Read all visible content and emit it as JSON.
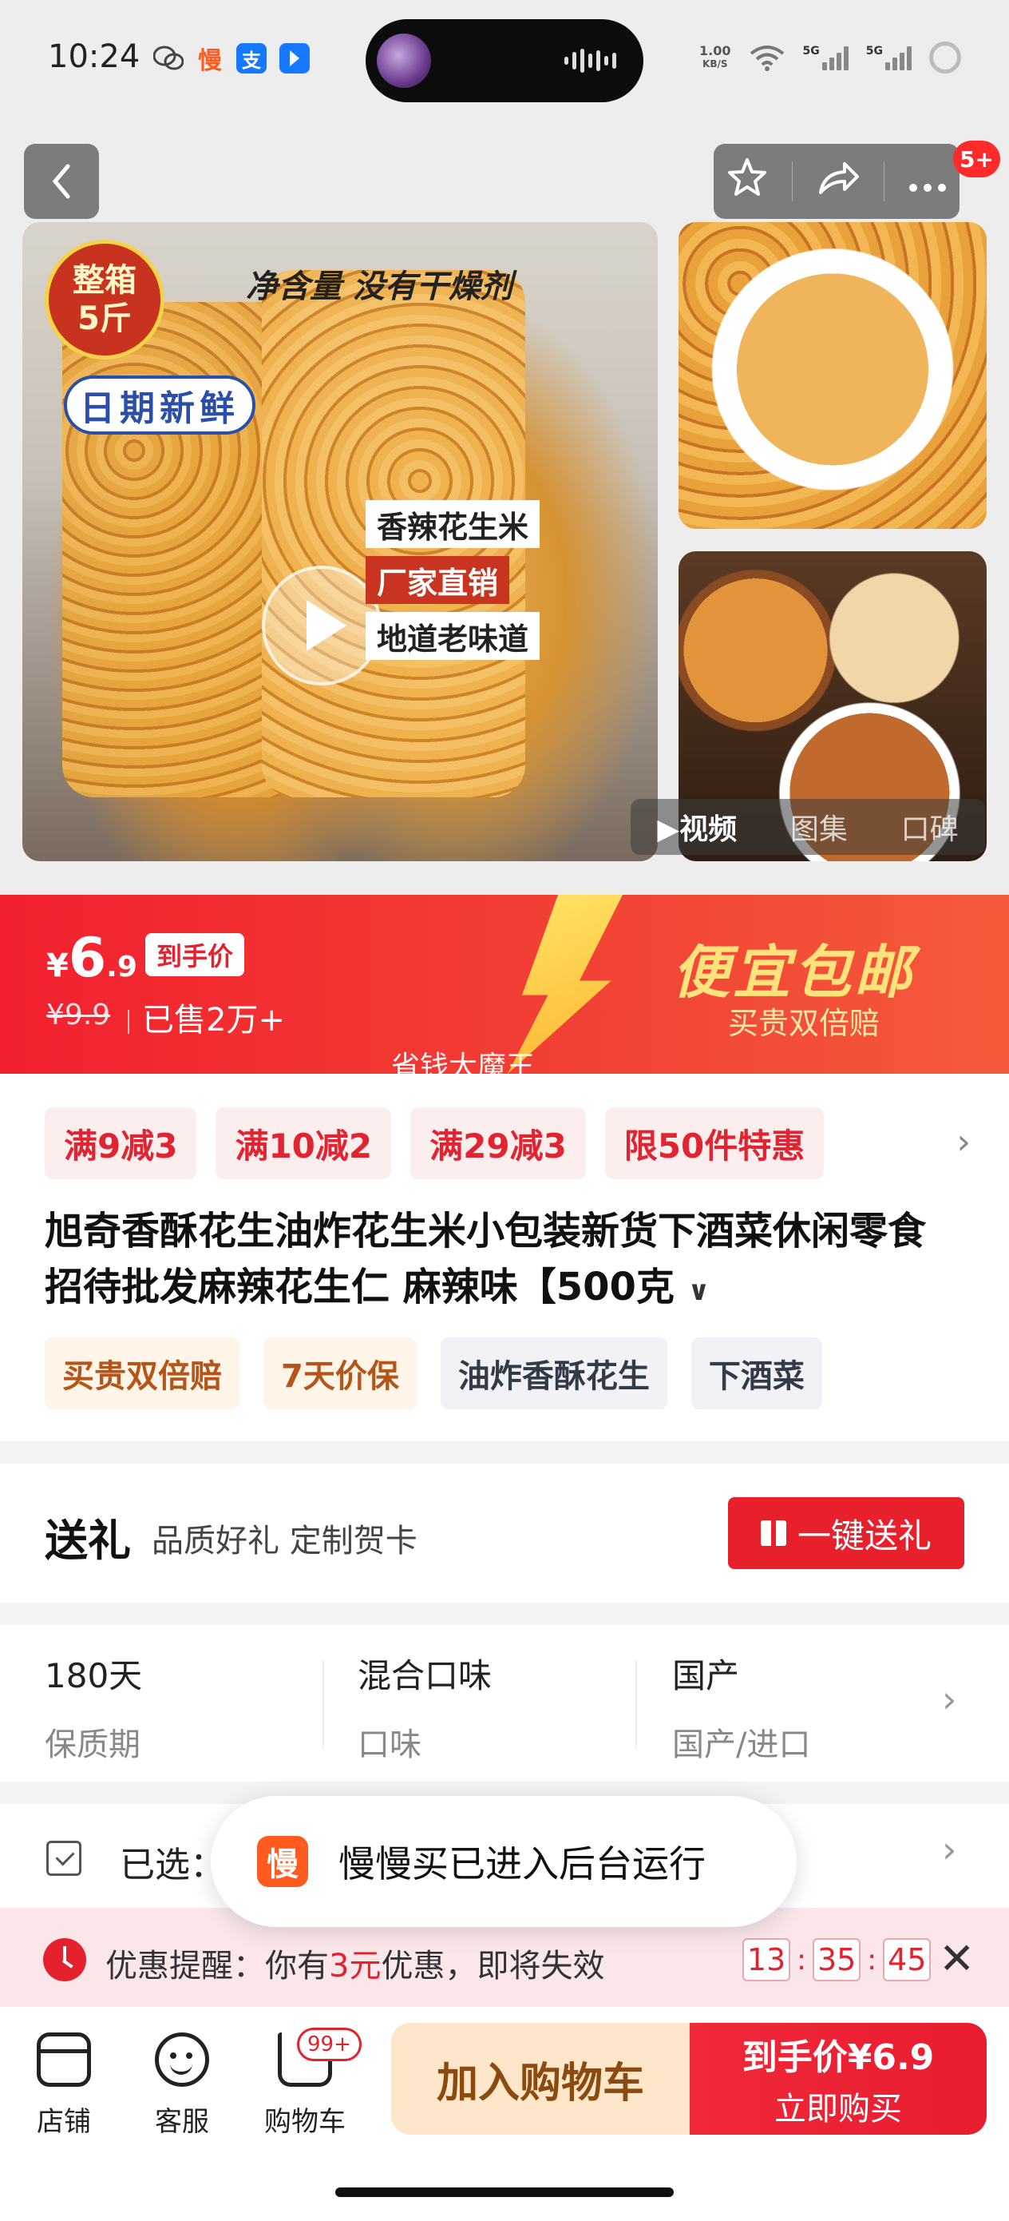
{
  "status_bar": {
    "time": "10:24",
    "app_icons": [
      "wechat-icon",
      "manmanmai-icon",
      "alipay-icon",
      "app-arrow-icon"
    ],
    "manmanmai_char": "慢",
    "alipay_char": "支",
    "net_speed_value": "1.00",
    "net_speed_unit": "KB/S",
    "sim1_label": "5G",
    "sim2_label": "5G"
  },
  "gallery": {
    "badge_count": "5+",
    "main_image": {
      "stamp_line1": "整箱",
      "stamp_line2": "5斤",
      "net_weight_text": "净含量  没有干燥剂",
      "fresh_text": "日期新鲜",
      "tagline1": "香辣花生米",
      "tagline2": "厂家直销",
      "tagline3": "地道老味道"
    },
    "media_tabs": [
      "视频",
      "图集",
      "口碑"
    ],
    "active_tab": "视频"
  },
  "price_banner": {
    "currency": "¥",
    "price_int": "6",
    "price_dec": ".9",
    "price_tag": "到手价",
    "old_price": "¥9.9",
    "sold": "已售2万+",
    "promo_big": "便宜包邮",
    "promo_small": "买贵双倍赔",
    "watermark": "省钱大魔王"
  },
  "info": {
    "coupons": [
      "满9减3",
      "满10减2",
      "满29减3",
      "限50件特惠"
    ],
    "title": "旭奇香酥花生油炸花生米小包装新货下酒菜休闲零食招待批发麻辣花生仁 麻辣味【500克",
    "chips": [
      {
        "label": "买贵双倍赔",
        "style": "orange"
      },
      {
        "label": "7天价保",
        "style": "orange"
      },
      {
        "label": "油炸香酥花生",
        "style": "gray"
      },
      {
        "label": "下酒菜",
        "style": "gray"
      }
    ]
  },
  "gift": {
    "title": "送礼",
    "subtitle": "品质好礼 定制贺卡",
    "button": "一键送礼"
  },
  "specs": [
    {
      "value": "180天",
      "key": "保质期"
    },
    {
      "value": "混合口味",
      "key": "口味"
    },
    {
      "value": "国产",
      "key": "国产/进口"
    }
  ],
  "selected": {
    "label": "已选："
  },
  "toast": {
    "logo_char": "慢",
    "text": "慢慢买已进入后台运行"
  },
  "reminder": {
    "prefix": "优惠提醒：你有",
    "amount": "3元",
    "suffix": "优惠，即将失效",
    "timer": {
      "h": "13",
      "m": "35",
      "s": "45"
    }
  },
  "bottom_bar": {
    "tabs": [
      "店铺",
      "客服",
      "购物车"
    ],
    "cart_badge": "99+",
    "add_to_cart": "加入购物车",
    "buy_line1": "到手价¥6.9",
    "buy_line2": "立即购买"
  },
  "colors": {
    "accent_red": "#e5212e",
    "price_banner": "#f2202f",
    "promo_gold": "#ffe27a",
    "cart_button_bg": "#fde6c9"
  }
}
